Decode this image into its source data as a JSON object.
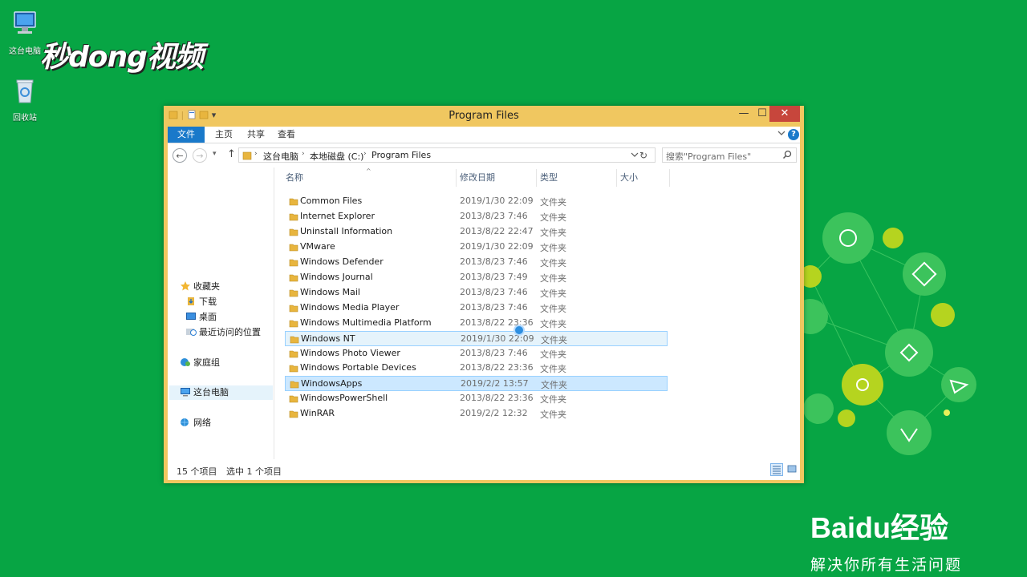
{
  "desktop": {
    "icons": [
      {
        "label": "这台电脑",
        "icon": "computer-icon"
      },
      {
        "label": "回收站",
        "icon": "recycle-bin-icon"
      }
    ],
    "watermark_top": "秒dong视频",
    "baidu_logo": "Baidu经验",
    "baidu_slogan": "解决你所有生活问题"
  },
  "window": {
    "title": "Program Files",
    "qat_dropdown": "▾",
    "min_label": "—",
    "max_label": "☐",
    "close_label": "✕",
    "accent_color": "#f0c760"
  },
  "ribbon": {
    "file_tab": "文件",
    "tabs": [
      "主页",
      "共享",
      "查看"
    ],
    "expand_icon": "chevron-down-icon",
    "help_label": "?"
  },
  "navigation": {
    "back_label": "←",
    "forward_label": "→",
    "recent_label": "▾",
    "up_label": "↑",
    "breadcrumbs": [
      "这台电脑",
      "本地磁盘 (C:)",
      "Program Files"
    ],
    "refresh_label": "↻",
    "search_placeholder": "搜索\"Program Files\""
  },
  "sidebar": {
    "favorites": "收藏夹",
    "favorite_items": [
      "下载",
      "桌面",
      "最近访问的位置"
    ],
    "homegroup": "家庭组",
    "this_pc": "这台电脑",
    "network": "网络"
  },
  "columns": {
    "name": "名称",
    "date": "修改日期",
    "type": "类型",
    "size": "大小"
  },
  "files": [
    {
      "name": "Common Files",
      "date": "2019/1/30 22:09",
      "type": "文件夹"
    },
    {
      "name": "Internet Explorer",
      "date": "2013/8/23 7:46",
      "type": "文件夹"
    },
    {
      "name": "Uninstall Information",
      "date": "2013/8/22 22:47",
      "type": "文件夹"
    },
    {
      "name": "VMware",
      "date": "2019/1/30 22:09",
      "type": "文件夹"
    },
    {
      "name": "Windows Defender",
      "date": "2013/8/23 7:46",
      "type": "文件夹"
    },
    {
      "name": "Windows Journal",
      "date": "2013/8/23 7:49",
      "type": "文件夹"
    },
    {
      "name": "Windows Mail",
      "date": "2013/8/23 7:46",
      "type": "文件夹"
    },
    {
      "name": "Windows Media Player",
      "date": "2013/8/23 7:46",
      "type": "文件夹"
    },
    {
      "name": "Windows Multimedia Platform",
      "date": "2013/8/22 23:36",
      "type": "文件夹"
    },
    {
      "name": "Windows NT",
      "date": "2019/1/30 22:09",
      "type": "文件夹",
      "state": "hover"
    },
    {
      "name": "Windows Photo Viewer",
      "date": "2013/8/23 7:46",
      "type": "文件夹"
    },
    {
      "name": "Windows Portable Devices",
      "date": "2013/8/22 23:36",
      "type": "文件夹"
    },
    {
      "name": "WindowsApps",
      "date": "2019/2/2 13:57",
      "type": "文件夹",
      "state": "selected"
    },
    {
      "name": "WindowsPowerShell",
      "date": "2013/8/22 23:36",
      "type": "文件夹"
    },
    {
      "name": "WinRAR",
      "date": "2019/2/2 12:32",
      "type": "文件夹"
    }
  ],
  "status": {
    "item_count": "15 个项目",
    "selected_count": "选中 1 个项目"
  }
}
